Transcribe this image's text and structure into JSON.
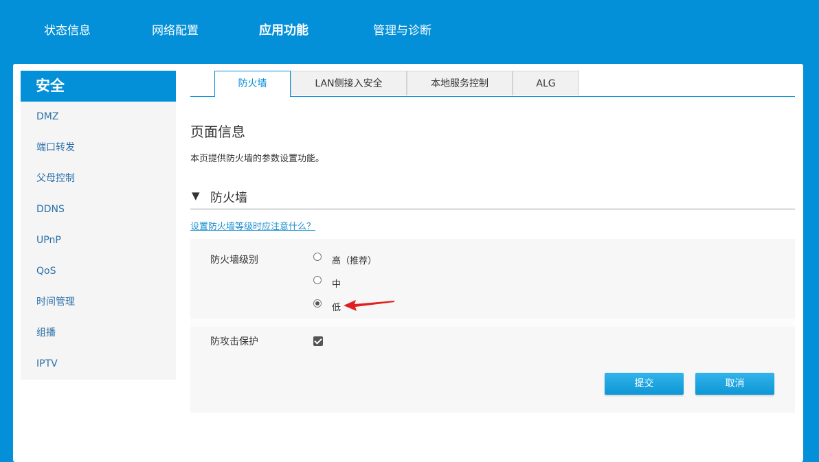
{
  "nav": {
    "items": [
      {
        "label": "状态信息"
      },
      {
        "label": "网络配置"
      },
      {
        "label": "应用功能",
        "active": true
      },
      {
        "label": "管理与诊断"
      }
    ]
  },
  "sidebar": {
    "header": "安全",
    "items": [
      {
        "label": "DMZ"
      },
      {
        "label": "端口转发"
      },
      {
        "label": "父母控制"
      },
      {
        "label": "DDNS"
      },
      {
        "label": "UPnP"
      },
      {
        "label": "QoS"
      },
      {
        "label": "时间管理"
      },
      {
        "label": "组播"
      },
      {
        "label": "IPTV"
      }
    ]
  },
  "tabs": [
    {
      "label": "防火墙",
      "active": true
    },
    {
      "label": "LAN侧接入安全"
    },
    {
      "label": "本地服务控制"
    },
    {
      "label": "ALG"
    }
  ],
  "page": {
    "title": "页面信息",
    "description": "本页提供防火墙的参数设置功能。"
  },
  "section": {
    "title": "防火墙",
    "help_link": "设置防火墙等级时应注意什么？"
  },
  "form": {
    "level_label": "防火墙级别",
    "levels": [
      {
        "label": "高（推荐）",
        "checked": false
      },
      {
        "label": "中",
        "checked": false
      },
      {
        "label": "低",
        "checked": true
      }
    ],
    "attack_label": "防攻击保护",
    "attack_protection": true,
    "submit_label": "提交",
    "cancel_label": "取消"
  },
  "colors": {
    "brand": "#0490d8",
    "annotation_arrow": "#e02020"
  }
}
